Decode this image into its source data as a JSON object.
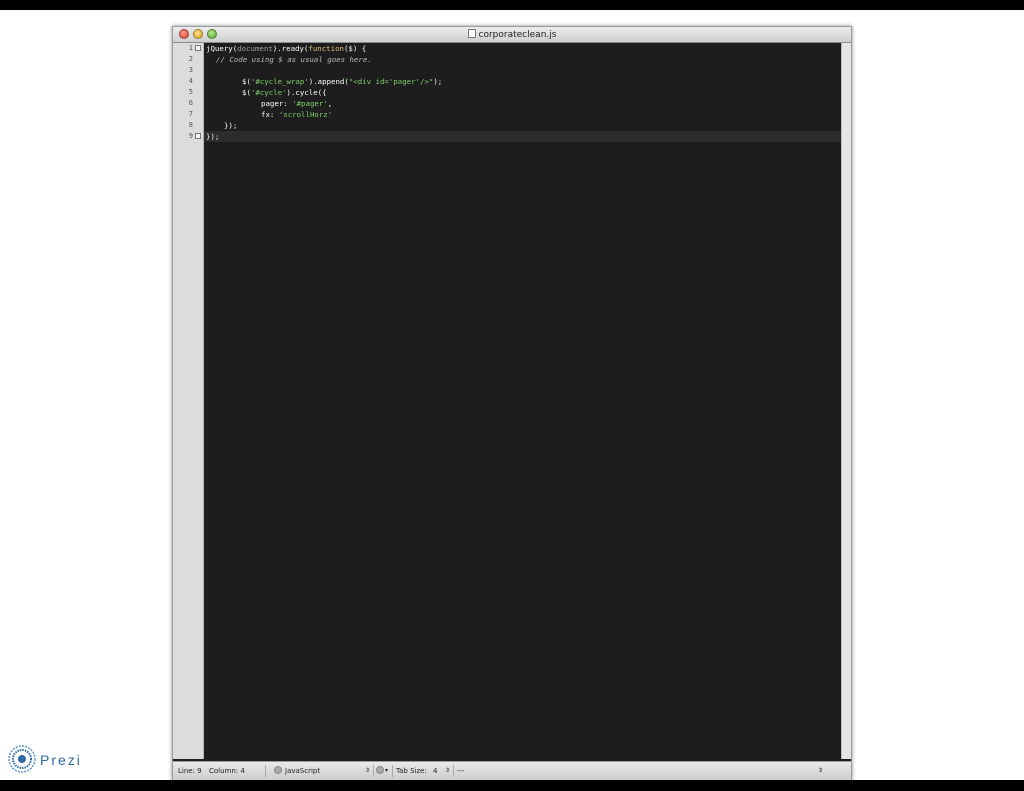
{
  "window": {
    "title": "corporateclean.js"
  },
  "gutter": {
    "line_numbers": [
      "1",
      "2",
      "3",
      "4",
      "5",
      "6",
      "7",
      "8",
      "9"
    ]
  },
  "code": {
    "line1": {
      "a": "jQuery(",
      "b": "document",
      "c": ").ready(",
      "d": "function",
      "e": "($) {"
    },
    "line2": "// Code using $ as usual goes here.",
    "line4": {
      "a": "$(",
      "b": "'#cycle_wrap'",
      "c": ").append(",
      "d": "\"<div id='pager'/>\"",
      "e": ");"
    },
    "line5": {
      "a": "$(",
      "b": "'#cycle'",
      "c": ").cycle({"
    },
    "line6": {
      "a": "pager: ",
      "b": "'#pager'",
      "c": ","
    },
    "line7": {
      "a": "fx: ",
      "b": "'scrollHorz'"
    },
    "line8": "});",
    "line9": "});"
  },
  "statusbar": {
    "line": "Line: 9",
    "column": "Column: 4",
    "language": "JavaScript",
    "tab_size": "Tab Size:",
    "tab_value": "4",
    "symbol": "---"
  },
  "logo": {
    "text": "Prezi"
  }
}
